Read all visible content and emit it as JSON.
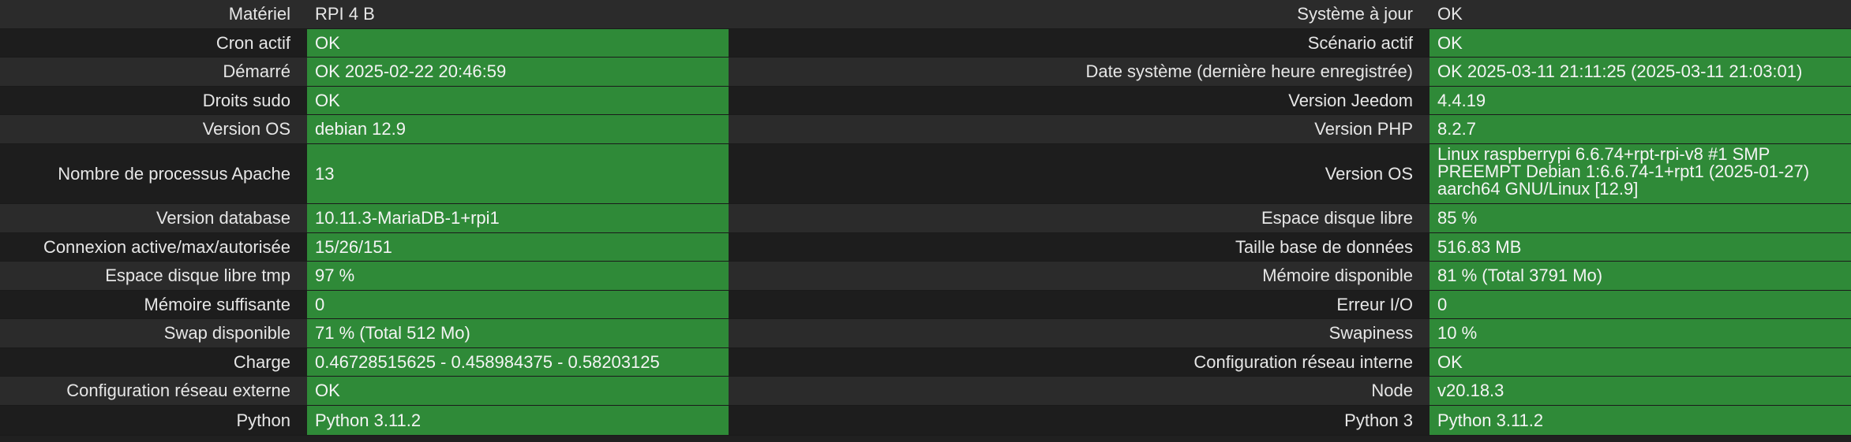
{
  "rows": [
    {
      "l1": "Matériel",
      "v1": "RPI 4 B",
      "s1": "plain",
      "l2": "Système à jour",
      "v2": "OK",
      "s2": "plain"
    },
    {
      "l1": "Cron actif",
      "v1": "OK",
      "s1": "ok",
      "l2": "Scénario actif",
      "v2": "OK",
      "s2": "ok"
    },
    {
      "l1": "Démarré",
      "v1": "OK 2025-02-22 20:46:59",
      "s1": "ok",
      "l2": "Date système (dernière heure enregistrée)",
      "v2": "OK 2025-03-11 21:11:25 (2025-03-11 21:03:01)",
      "s2": "ok"
    },
    {
      "l1": "Droits sudo",
      "v1": "OK",
      "s1": "ok",
      "l2": "Version Jeedom",
      "v2": "4.4.19",
      "s2": "ok"
    },
    {
      "l1": "Version OS",
      "v1": "debian 12.9",
      "s1": "ok",
      "l2": "Version PHP",
      "v2": "8.2.7",
      "s2": "ok"
    },
    {
      "l1": "Nombre de processus Apache",
      "v1": "13",
      "s1": "ok",
      "l2": "Version OS",
      "v2": "Linux raspberrypi 6.6.74+rpt-rpi-v8 #1 SMP PREEMPT Debian 1:6.6.74-1+rpt1 (2025-01-27) aarch64 GNU/Linux [12.9]",
      "s2": "ok"
    },
    {
      "l1": "Version database",
      "v1": "10.11.3-MariaDB-1+rpi1",
      "s1": "ok",
      "l2": "Espace disque libre",
      "v2": "85 %",
      "s2": "ok"
    },
    {
      "l1": "Connexion active/max/autorisée",
      "v1": "15/26/151",
      "s1": "ok",
      "l2": "Taille base de données",
      "v2": "516.83 MB",
      "s2": "ok"
    },
    {
      "l1": "Espace disque libre tmp",
      "v1": "97 %",
      "s1": "ok",
      "l2": "Mémoire disponible",
      "v2": "81 % (Total 3791 Mo)",
      "s2": "ok"
    },
    {
      "l1": "Mémoire suffisante",
      "v1": "0",
      "s1": "ok",
      "l2": "Erreur I/O",
      "v2": "0",
      "s2": "ok"
    },
    {
      "l1": "Swap disponible",
      "v1": "71 % (Total 512 Mo)",
      "s1": "ok",
      "l2": "Swapiness",
      "v2": "10 %",
      "s2": "ok"
    },
    {
      "l1": "Charge",
      "v1": "0.46728515625 - 0.458984375 - 0.58203125",
      "s1": "ok",
      "l2": "Configuration réseau interne",
      "v2": "OK",
      "s2": "ok"
    },
    {
      "l1": "Configuration réseau externe",
      "v1": "OK",
      "s1": "ok",
      "l2": "Node",
      "v2": "v20.18.3",
      "s2": "ok"
    },
    {
      "l1": "Python",
      "v1": "Python 3.11.2",
      "s1": "ok",
      "l2": "Python 3",
      "v2": "Python 3.11.2",
      "s2": "ok"
    }
  ]
}
